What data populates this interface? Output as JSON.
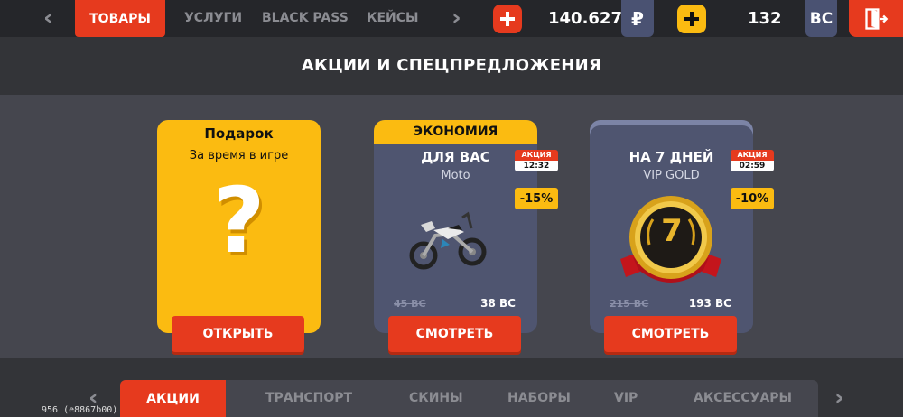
{
  "topbar": {
    "tabs": [
      {
        "label": "ТОВАРЫ",
        "active": true
      },
      {
        "label": "УСЛУГИ"
      },
      {
        "label": "BLACK PASS"
      },
      {
        "label": "КЕЙСЫ"
      }
    ],
    "rub": {
      "value": "140.627",
      "symbol": "₽",
      "plus_color": "#e63a1e"
    },
    "bc": {
      "value": "132",
      "symbol": "BC",
      "plus_color": "#fbbb11"
    },
    "icons": {
      "left": "chevron-left-icon",
      "right": "chevron-right-icon",
      "exit": "exit-door-icon"
    }
  },
  "page_title": "АКЦИИ И СПЕЦПРЕДЛОЖЕНИЯ",
  "cards": {
    "gift": {
      "title": "Подарок",
      "subtitle": "За время в игре",
      "glyph": "?",
      "button": "ОТКРЫТЬ"
    },
    "moto": {
      "header": "ЭКОНОМИЯ",
      "title": "ДЛЯ ВАС",
      "subtitle": "Moto",
      "promo_label": "АКЦИЯ",
      "promo_time": "12:32",
      "discount": "-15%",
      "old_price": "45 BC",
      "new_price": "38 BC",
      "button": "СМОТРЕТЬ"
    },
    "vip": {
      "title": "НА 7 ДНЕЙ",
      "subtitle": "VIP GOLD",
      "promo_label": "АКЦИЯ",
      "promo_time": "02:59",
      "discount": "-10%",
      "medal_number": "7",
      "old_price": "215 BC",
      "new_price": "193 BC",
      "button": "СМОТРЕТЬ"
    }
  },
  "bottom_nav": {
    "tabs": [
      {
        "label": "АКЦИИ",
        "active": true
      },
      {
        "label": "ТРАНСПОРТ"
      },
      {
        "label": "СКИНЫ"
      },
      {
        "label": "НАБОРЫ"
      },
      {
        "label": "VIP"
      },
      {
        "label": "АКСЕССУАРЫ"
      }
    ]
  },
  "debug_text": "956 (e8867b00)",
  "colors": {
    "accent": "#e63a1e",
    "yellow": "#fbbb11",
    "card_blue": "#4f5570",
    "background": "#333438"
  }
}
